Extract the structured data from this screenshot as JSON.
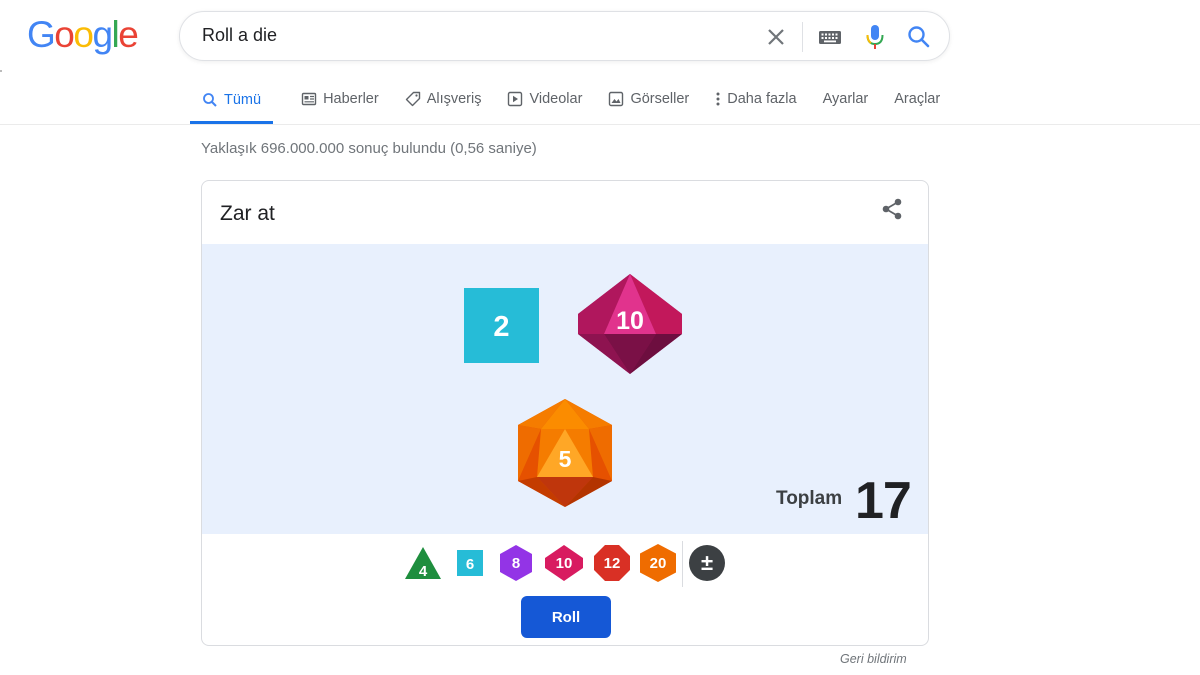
{
  "logo": {
    "letters": [
      "G",
      "o",
      "o",
      "g",
      "l",
      "e"
    ],
    "colors": [
      "#4285F4",
      "#EA4335",
      "#FBBC05",
      "#4285F4",
      "#34A853",
      "#EA4335"
    ]
  },
  "search": {
    "query": "Roll a die"
  },
  "tabs": [
    {
      "label": "Tümü",
      "icon": "search-icon",
      "active": true
    },
    {
      "label": "Haberler",
      "icon": "news-icon"
    },
    {
      "label": "Alışveriş",
      "icon": "tag-icon"
    },
    {
      "label": "Videolar",
      "icon": "play-icon"
    },
    {
      "label": "Görseller",
      "icon": "image-icon"
    },
    {
      "label": "Daha fazla",
      "icon": "more-vert-icon"
    },
    {
      "label": "Ayarlar"
    },
    {
      "label": "Araçlar"
    }
  ],
  "stats": "Yaklaşık 696.000.000 sonuç bulundu (0,56 saniye)",
  "card": {
    "title": "Zar at",
    "dice": [
      {
        "sides": 6,
        "value": "2",
        "color": "#26bcd7"
      },
      {
        "sides": 10,
        "value": "10",
        "color": "#c2185b"
      },
      {
        "sides": 20,
        "value": "5",
        "color": "#ef6c00"
      }
    ],
    "total_label": "Toplam",
    "total_value": "17",
    "picker": [
      {
        "label": "4",
        "color": "#1e8e3e"
      },
      {
        "label": "6",
        "color": "#26bcd7"
      },
      {
        "label": "8",
        "color": "#9334e6"
      },
      {
        "label": "10",
        "color": "#d81b60"
      },
      {
        "label": "12",
        "color": "#d93025"
      },
      {
        "label": "20",
        "color": "#ef6c00"
      },
      {
        "label": "±",
        "color": "#3c4043"
      }
    ],
    "roll_label": "Roll"
  },
  "feedback": "Geri bildirim"
}
